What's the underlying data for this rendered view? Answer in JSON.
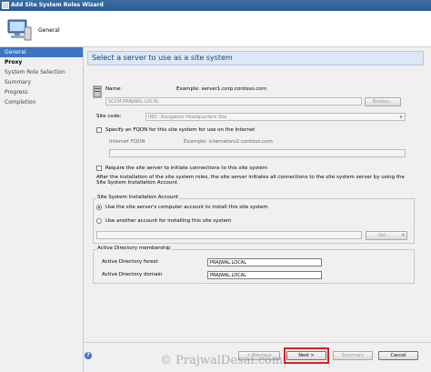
{
  "window": {
    "title": "Add Site System Roles Wizard"
  },
  "header": {
    "title": "General"
  },
  "sidebar": {
    "items": [
      {
        "label": "General",
        "active": true
      },
      {
        "label": "Proxy"
      },
      {
        "label": "System Role Selection"
      },
      {
        "label": "Summary"
      },
      {
        "label": "Progress"
      },
      {
        "label": "Completion"
      }
    ]
  },
  "main": {
    "banner": "Select a server to use as a site system",
    "name_label": "Name:",
    "name_example": "Example: server1.corp.contoso.com",
    "name_value": "SCCM.PRAJWAL.LOCAL",
    "browse_label": "Browse...",
    "site_code_label": "Site code:",
    "site_code_value": "IND - Bangalore Headquarters Site",
    "fqdn_checkbox_label": "Specify an FQDN for this site system for use on the Internet",
    "internet_fqdn_label": "Internet FQDN",
    "internet_fqdn_example": "Example: internetsrv2.contoso.com",
    "initiate_checkbox_label": "Require the site server to initiate connections to this site system",
    "initiate_note": "After the installation of the site system roles, the site server initiates all connections to the site system server by using the Site System Installation Account.",
    "install_account_group": "Site System Installation Account",
    "radio_computer_account": "Use the site server's computer account to install this site system",
    "radio_another_account": "Use another account for installing this site system",
    "set_label": "Set...",
    "ad_group": "Active Directory membership",
    "ad_forest_label": "Active Directory forest",
    "ad_forest_value": "PRAJWAL.LOCAL",
    "ad_domain_label": "Active Directory domain",
    "ad_domain_value": "PRAJWAL.LOCAL"
  },
  "footer": {
    "previous_label": "< Previous",
    "next_label": "Next >",
    "summary_label": "Summary",
    "cancel_label": "Cancel"
  },
  "watermark": "© PrajwalDesai.com",
  "colors": {
    "accent": "#3d74c4",
    "highlight": "#e01c1c"
  }
}
